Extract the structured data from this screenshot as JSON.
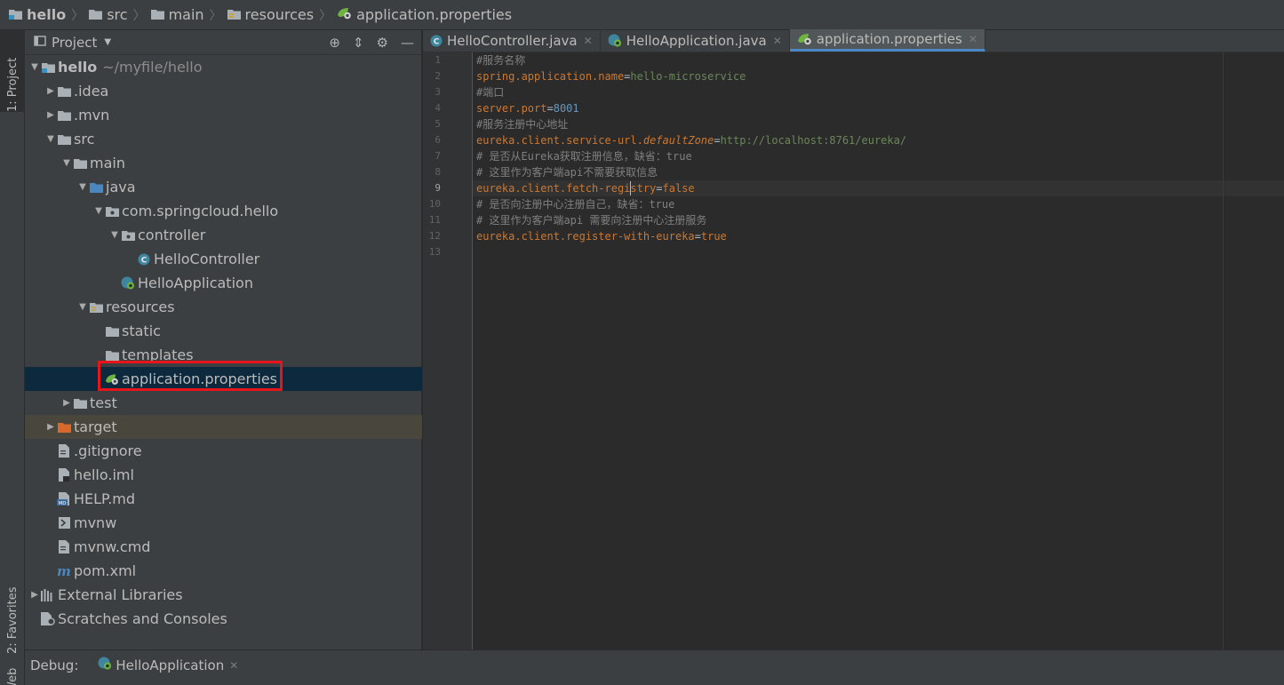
{
  "breadcrumb": [
    {
      "label": "hello",
      "icon": "project-folder-icon"
    },
    {
      "label": "src",
      "icon": "folder-icon"
    },
    {
      "label": "main",
      "icon": "folder-icon"
    },
    {
      "label": "resources",
      "icon": "resources-folder-icon"
    },
    {
      "label": "application.properties",
      "icon": "spring-properties-icon"
    }
  ],
  "left_strip": {
    "project_tab": "1: Project",
    "favorites_tab": "2: Favorites",
    "web_tab": "Web"
  },
  "project_panel": {
    "title": "Project",
    "tree": [
      {
        "label": "hello",
        "sub": "~/myfile/hello",
        "icon": "project-folder-icon",
        "expanded": true
      },
      {
        "label": ".idea",
        "icon": "folder-icon",
        "expanded": false
      },
      {
        "label": ".mvn",
        "icon": "folder-icon",
        "expanded": false
      },
      {
        "label": "src",
        "icon": "folder-icon",
        "expanded": true
      },
      {
        "label": "main",
        "icon": "folder-icon",
        "expanded": true
      },
      {
        "label": "java",
        "icon": "source-folder-icon",
        "expanded": true
      },
      {
        "label": "com.springcloud.hello",
        "icon": "package-icon",
        "expanded": true
      },
      {
        "label": "controller",
        "icon": "package-icon",
        "expanded": true
      },
      {
        "label": "HelloController",
        "icon": "java-class-icon"
      },
      {
        "label": "HelloApplication",
        "icon": "spring-boot-class-icon"
      },
      {
        "label": "resources",
        "icon": "resources-folder-icon",
        "expanded": true
      },
      {
        "label": "static",
        "icon": "folder-icon"
      },
      {
        "label": "templates",
        "icon": "folder-icon"
      },
      {
        "label": "application.properties",
        "icon": "spring-properties-icon",
        "selected": true
      },
      {
        "label": "test",
        "icon": "folder-icon",
        "expanded": false
      },
      {
        "label": "target",
        "icon": "excluded-folder-icon",
        "expanded": false
      },
      {
        "label": ".gitignore",
        "icon": "text-file-icon"
      },
      {
        "label": "hello.iml",
        "icon": "iml-file-icon"
      },
      {
        "label": "HELP.md",
        "icon": "markdown-file-icon"
      },
      {
        "label": "mvnw",
        "icon": "shell-file-icon"
      },
      {
        "label": "mvnw.cmd",
        "icon": "text-file-icon"
      },
      {
        "label": "pom.xml",
        "icon": "maven-icon"
      },
      {
        "label": "External Libraries",
        "icon": "libraries-icon",
        "expanded": false
      },
      {
        "label": "Scratches and Consoles",
        "icon": "scratches-icon"
      }
    ]
  },
  "editor": {
    "tabs": [
      {
        "label": "HelloController.java",
        "icon": "java-class-icon",
        "active": false
      },
      {
        "label": "HelloApplication.java",
        "icon": "spring-boot-class-icon",
        "active": false
      },
      {
        "label": "application.properties",
        "icon": "spring-properties-icon",
        "active": true
      }
    ],
    "current_line": 9,
    "lines": [
      [
        {
          "t": "#服务名称",
          "c": "comment"
        }
      ],
      [
        {
          "t": "spring.application.name",
          "c": "key"
        },
        {
          "t": "=",
          "c": "eq"
        },
        {
          "t": "hello-microservice",
          "c": "val"
        }
      ],
      [
        {
          "t": "#端口",
          "c": "comment"
        }
      ],
      [
        {
          "t": "server.port",
          "c": "key"
        },
        {
          "t": "=",
          "c": "eq"
        },
        {
          "t": "8001",
          "c": "num"
        }
      ],
      [
        {
          "t": "#服务注册中心地址",
          "c": "comment"
        }
      ],
      [
        {
          "t": "eureka.client.service-url.",
          "c": "key"
        },
        {
          "t": "defaultZone",
          "c": "it"
        },
        {
          "t": "=",
          "c": "eq"
        },
        {
          "t": "http://localhost:8761/eureka/",
          "c": "val"
        }
      ],
      [
        {
          "t": "# 是否从Eureka获取注册信息，缺省：true",
          "c": "comment"
        }
      ],
      [
        {
          "t": "# 这里作为客户端api不需要获取信息",
          "c": "comment"
        }
      ],
      [
        {
          "t": "eureka.client.fetch-registry",
          "c": "key"
        },
        {
          "t": "=",
          "c": "eq"
        },
        {
          "t": "false",
          "c": "key"
        }
      ],
      [
        {
          "t": "# 是否向注册中心注册自己，缺省：true",
          "c": "comment"
        }
      ],
      [
        {
          "t": "# 这里作为客户端api 需要向注册中心注册服务",
          "c": "comment"
        }
      ],
      [
        {
          "t": "eureka.client.register-with-eureka",
          "c": "key"
        },
        {
          "t": "=",
          "c": "eq"
        },
        {
          "t": "true",
          "c": "key"
        }
      ],
      []
    ]
  },
  "debug_bar": {
    "label": "Debug:",
    "tab_label": "HelloApplication",
    "tab_icon": "spring-boot-class-icon"
  },
  "colors": {
    "selection_highlight": "#e8141b",
    "selected_row": "#0d293e",
    "active_tab_underline": "#4a88c7"
  }
}
